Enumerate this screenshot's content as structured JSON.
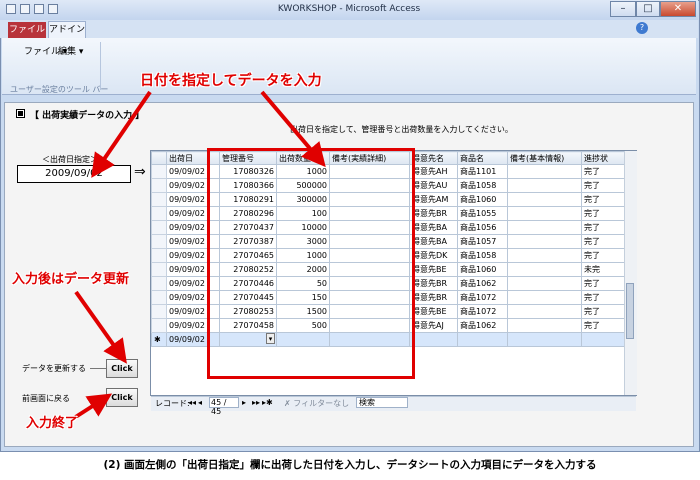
{
  "window": {
    "title": "KWORKSHOP - Microsoft Access",
    "minimize": "–",
    "maximize": "□",
    "close": "✕",
    "help_glyph": "?"
  },
  "ribbon": {
    "tabs": [
      "ファイル",
      "アドイン"
    ],
    "menus": [
      "ファイル ▾",
      "編集 ▾"
    ],
    "group_label": "ユーザー設定のツール バー"
  },
  "form": {
    "title": "【 出荷実績データの入力 】",
    "instruction": "出荷日を指定して、管理番号と出荷数量を入力してください。",
    "date_label": "＜出荷日指定＞",
    "date_value": "2009/09/02",
    "date_arrow": "⇒",
    "update_label": "データを更新する",
    "update_button": "Click",
    "return_label": "前画面に戻る",
    "return_button": "Click"
  },
  "sheet": {
    "columns": [
      "出荷日",
      "管理番号",
      "出荷数量",
      "備考(実績詳細)",
      "得意先名",
      "商品名",
      "備考(基本情報)",
      "進捗状"
    ],
    "rows": [
      [
        "09/09/02",
        "17080326",
        "1000",
        "",
        "得意先AH",
        "商品1101",
        "",
        "完了"
      ],
      [
        "09/09/02",
        "17080366",
        "500000",
        "",
        "得意先AU",
        "商品1058",
        "",
        "完了"
      ],
      [
        "09/09/02",
        "17080291",
        "300000",
        "",
        "得意先AM",
        "商品1060",
        "",
        "完了"
      ],
      [
        "09/09/02",
        "27080296",
        "100",
        "",
        "得意先BR",
        "商品1055",
        "",
        "完了"
      ],
      [
        "09/09/02",
        "27070437",
        "10000",
        "",
        "得意先BA",
        "商品1056",
        "",
        "完了"
      ],
      [
        "09/09/02",
        "27070387",
        "3000",
        "",
        "得意先BA",
        "商品1057",
        "",
        "完了"
      ],
      [
        "09/09/02",
        "27070465",
        "1000",
        "",
        "得意先DK",
        "商品1058",
        "",
        "完了"
      ],
      [
        "09/09/02",
        "27080252",
        "2000",
        "",
        "得意先BE",
        "商品1060",
        "",
        "未完"
      ],
      [
        "09/09/02",
        "27070446",
        "50",
        "",
        "得意先BR",
        "商品1062",
        "",
        "完了"
      ],
      [
        "09/09/02",
        "27070445",
        "150",
        "",
        "得意先BR",
        "商品1072",
        "",
        "完了"
      ],
      [
        "09/09/02",
        "27080253",
        "1500",
        "",
        "得意先BE",
        "商品1072",
        "",
        "完了"
      ],
      [
        "09/09/02",
        "27070458",
        "500",
        "",
        "得意先AJ",
        "商品1062",
        "",
        "完了"
      ]
    ],
    "new_row": {
      "marker": "✱",
      "date": "09/09/02"
    },
    "nav": {
      "record_label": "レコード:",
      "first": "◂◂",
      "prev": "◂",
      "position": "45 / 45",
      "next": "▸",
      "last": "▸▸",
      "new": "▸✱",
      "filter": "✗ フィルターなし",
      "search": "検索"
    }
  },
  "annotations": {
    "top": "日付を指定してデータを入力",
    "update": "入力後はデータ更新",
    "end": "入力終了"
  },
  "caption": "(2) 画面左側の「出荷日指定」欄に出荷した日付を入力し、データシートの入力項目にデータを入力する",
  "colors": {
    "accent_red": "#e00000",
    "file_tab": "#b8333a",
    "window_frame": "#c9daf0"
  }
}
